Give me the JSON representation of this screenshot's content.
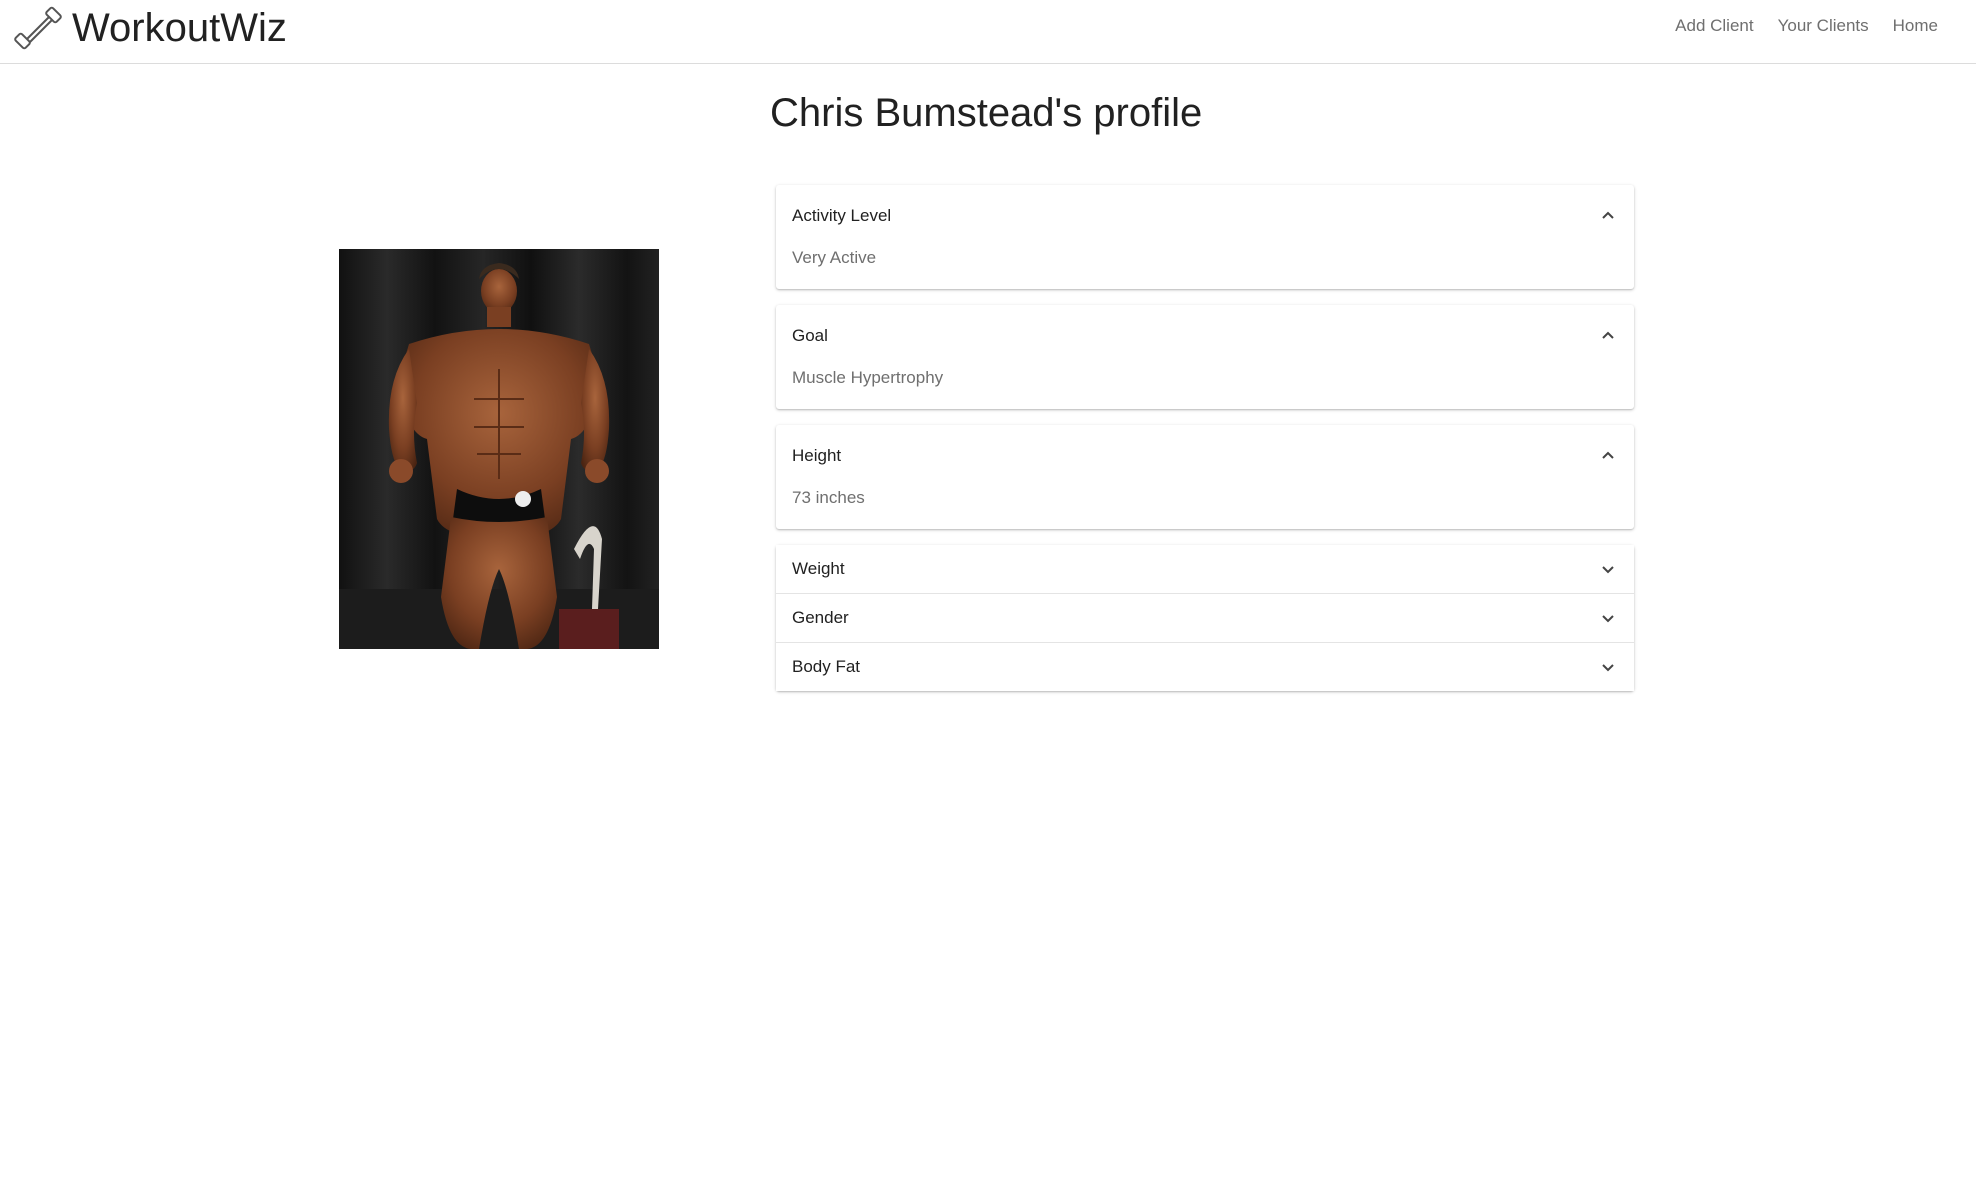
{
  "navbar": {
    "brand": "WorkoutWiz",
    "links": [
      "Add Client",
      "Your Clients",
      "Home"
    ]
  },
  "page": {
    "title": "Chris Bumstead's profile"
  },
  "profile_sections": [
    {
      "label": "Activity Level",
      "value": "Very Active",
      "expanded": true
    },
    {
      "label": "Goal",
      "value": "Muscle Hypertrophy",
      "expanded": true
    },
    {
      "label": "Height",
      "value": "73 inches",
      "expanded": true
    },
    {
      "label": "Weight",
      "expanded": false
    },
    {
      "label": "Gender",
      "expanded": false
    },
    {
      "label": "Body Fat",
      "expanded": false
    }
  ],
  "icons": {
    "brand": "dumbbell-icon",
    "expanded": "chevron-up-icon",
    "collapsed": "chevron-down-icon"
  }
}
